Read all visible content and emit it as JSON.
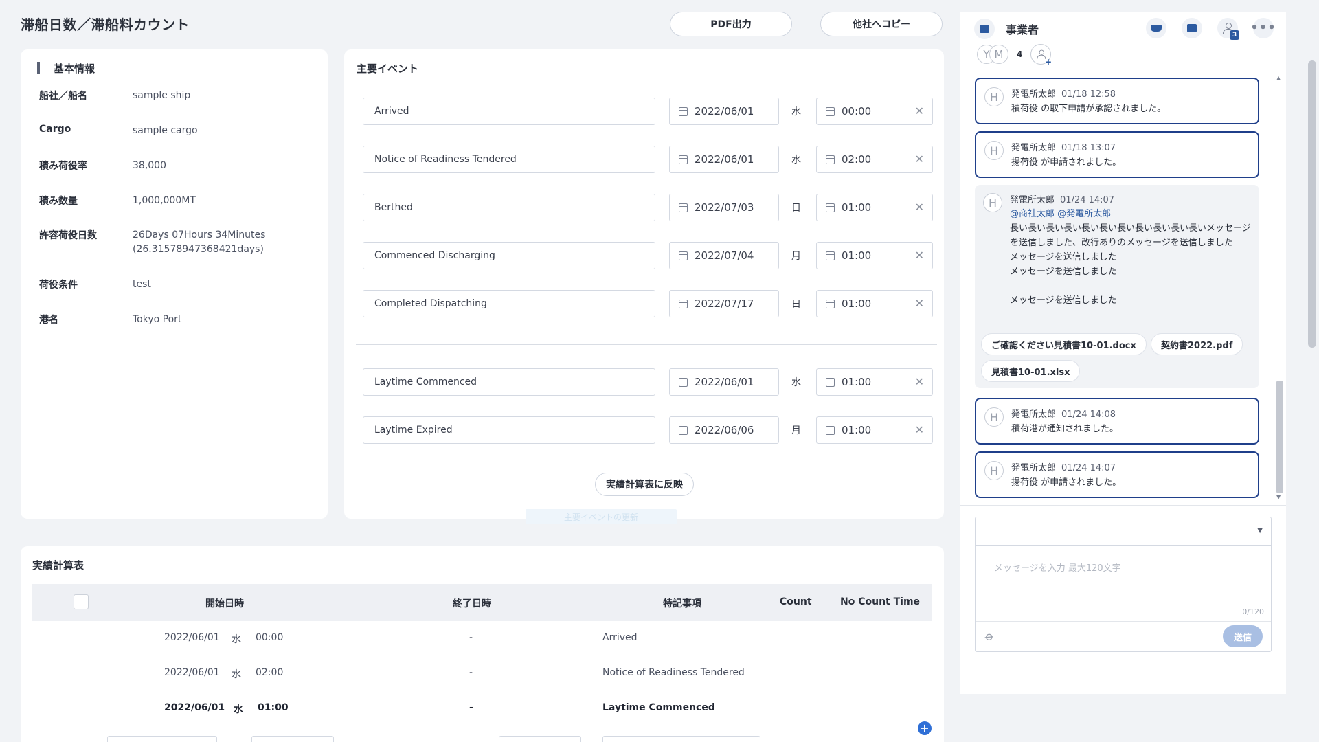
{
  "page": {
    "title": "滞船日数／滞船料カウント",
    "pdf_button": "PDF出力",
    "copy_button": "他社へコピー"
  },
  "basic_info": {
    "title": "基本情報",
    "rows": [
      {
        "key": "船社／船名",
        "value": "sample ship"
      },
      {
        "key": "Cargo",
        "value": "sample cargo"
      },
      {
        "key": "積み荷役率",
        "value": "38,000"
      },
      {
        "key": "積み数量",
        "value": "1,000,000MT"
      },
      {
        "key": "許容荷役日数",
        "value": "26Days 07Hours 34Minutes\n(26.315789473684​21days)"
      },
      {
        "key": "荷役条件",
        "value": "test"
      },
      {
        "key": "港名",
        "value": "Tokyo Port"
      }
    ]
  },
  "events": {
    "title": "主要イベント",
    "rows": [
      {
        "name": "Arrived",
        "date": "2022/06/01",
        "dow": "水",
        "time": "00:00"
      },
      {
        "name": "Notice of Readiness Tendered",
        "date": "2022/06/01",
        "dow": "水",
        "time": "02:00"
      },
      {
        "name": "Berthed",
        "date": "2022/07/03",
        "dow": "日",
        "time": "01:00"
      },
      {
        "name": "Commenced Discharging",
        "date": "2022/07/04",
        "dow": "月",
        "time": "01:00"
      },
      {
        "name": "Completed Dispatching",
        "date": "2022/07/17",
        "dow": "日",
        "time": "01:00"
      }
    ],
    "laytime_rows": [
      {
        "name": "Laytime Commenced",
        "date": "2022/06/01",
        "dow": "水",
        "time": "01:00"
      },
      {
        "name": "Laytime Expired",
        "date": "2022/06/06",
        "dow": "月",
        "time": "01:00"
      }
    ],
    "reflect_button": "実績計算表に反映",
    "ghost_button": "主要イベントの更新"
  },
  "results": {
    "title": "実績計算表",
    "headers": {
      "start": "開始日時",
      "end": "終了日時",
      "remarks": "特記事項",
      "count": "Count",
      "no_count": "No Count Time"
    },
    "rows": [
      {
        "date": "2022/06/01",
        "dow": "水",
        "time": "00:00",
        "end": "-",
        "remarks": "Arrived",
        "bold": false
      },
      {
        "date": "2022/06/01",
        "dow": "水",
        "time": "02:00",
        "end": "-",
        "remarks": "Notice of Readiness Tendered",
        "bold": false
      },
      {
        "date": "2022/06/01",
        "dow": "水",
        "time": "01:00",
        "end": "-",
        "remarks": "Laytime Commenced",
        "bold": true
      }
    ]
  },
  "chat": {
    "title": "事業者",
    "member_count": "4",
    "participants_badge": "3",
    "avatars": [
      "Y",
      "M"
    ],
    "messages": [
      {
        "avatar": "H",
        "author": "発電所太郎",
        "time": "01/18 12:58",
        "body": "積荷役 の取下申請が承認されました。",
        "style": "hl"
      },
      {
        "avatar": "H",
        "author": "発電所太郎",
        "time": "01/18 13:07",
        "body": "揚荷役 が申請されました。",
        "style": "hl"
      },
      {
        "avatar": "H",
        "author": "発電所太郎",
        "time": "01/24 14:07",
        "mentions": "@商社太郎 @発電所太郎",
        "body": "長い長い長い長い長い長い長い長い長い長い長いメッセージを送信しました、改行ありのメッセージを送信しました\nメッセージを送信しました\nメッセージを送信しました\n\nメッセージを送信しました",
        "style": "gray",
        "attachments": [
          "ご確認ください見積書10-01.docx",
          "契約書2022.pdf",
          "見積書10-01.xlsx"
        ]
      },
      {
        "avatar": "H",
        "author": "発電所太郎",
        "time": "01/24 14:08",
        "body": "積荷港が通知されました。",
        "style": "hl"
      },
      {
        "avatar": "H",
        "author": "発電所太郎",
        "time": "01/24 14:07",
        "body": "揚荷役 が申請されました。",
        "style": "hl"
      }
    ],
    "input_placeholder": "メッセージを入力 最大120文字",
    "char_counter": "0/120",
    "send_button": "送信"
  },
  "icons": {
    "ship": "ship-icon",
    "document": "document-icon",
    "participants": "participants-icon",
    "more": "more-icon",
    "add_member": "add-member-icon",
    "calendar": "calendar-icon",
    "clock": "clock-icon",
    "clear": "clear-icon",
    "attach": "paperclip-icon",
    "add_row": "plus-icon"
  },
  "colors": {
    "accent": "#1f3f8a",
    "primary": "#2c5aa0",
    "send_disabled": "#a9bfe3"
  }
}
